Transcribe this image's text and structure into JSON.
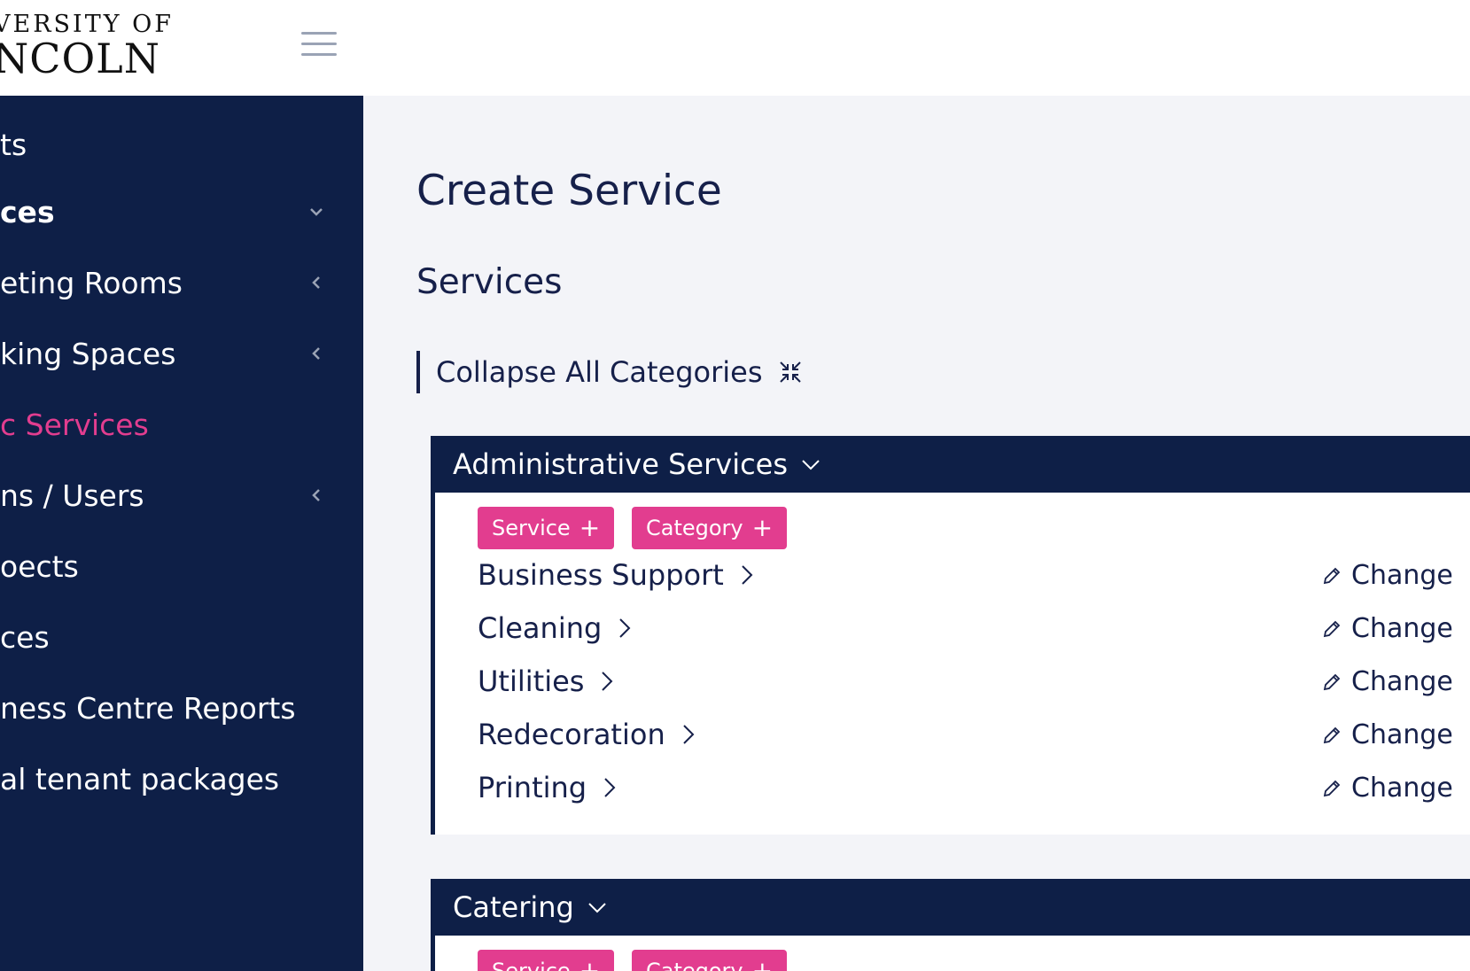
{
  "logo": {
    "line1": "VERSITY OF",
    "line2": "NCOLN"
  },
  "sidebar": {
    "items": [
      {
        "label": "ts",
        "chevron": "none",
        "active": false,
        "bold": false
      },
      {
        "label": "ces",
        "chevron": "chevron-down",
        "active": false,
        "bold": true
      },
      {
        "label": "eting Rooms",
        "chevron": "chevron-left",
        "active": false,
        "bold": false
      },
      {
        "label": "king Spaces",
        "chevron": "chevron-left",
        "active": false,
        "bold": false
      },
      {
        "label": "c Services",
        "chevron": "none",
        "active": true,
        "bold": false
      },
      {
        "label": "ns / Users",
        "chevron": "chevron-left",
        "active": false,
        "bold": false
      },
      {
        "label": "oects",
        "chevron": "none",
        "active": false,
        "bold": false
      },
      {
        "label": "ces",
        "chevron": "none",
        "active": false,
        "bold": false
      },
      {
        "label": "ness Centre Reports",
        "chevron": "none",
        "active": false,
        "bold": false
      },
      {
        "label": "al tenant packages",
        "chevron": "none",
        "active": false,
        "bold": false
      }
    ]
  },
  "main": {
    "title": "Create Service",
    "section_title": "Services",
    "collapse_all_label": "Collapse All Categories",
    "categories": [
      {
        "name": "Administrative Services",
        "add_service_label": "Service",
        "add_category_label": "Category",
        "services": [
          {
            "name": "Business Support",
            "action": "Change"
          },
          {
            "name": "Cleaning",
            "action": "Change"
          },
          {
            "name": "Utilities",
            "action": "Change"
          },
          {
            "name": "Redecoration",
            "action": "Change"
          },
          {
            "name": "Printing",
            "action": "Change"
          }
        ]
      },
      {
        "name": "Catering",
        "add_service_label": "Service",
        "add_category_label": "Category",
        "services": []
      }
    ]
  },
  "colors": {
    "navy": "#0e1f47",
    "accent": "#e23d8f",
    "background": "#f3f4f8",
    "text": "#16204a"
  }
}
